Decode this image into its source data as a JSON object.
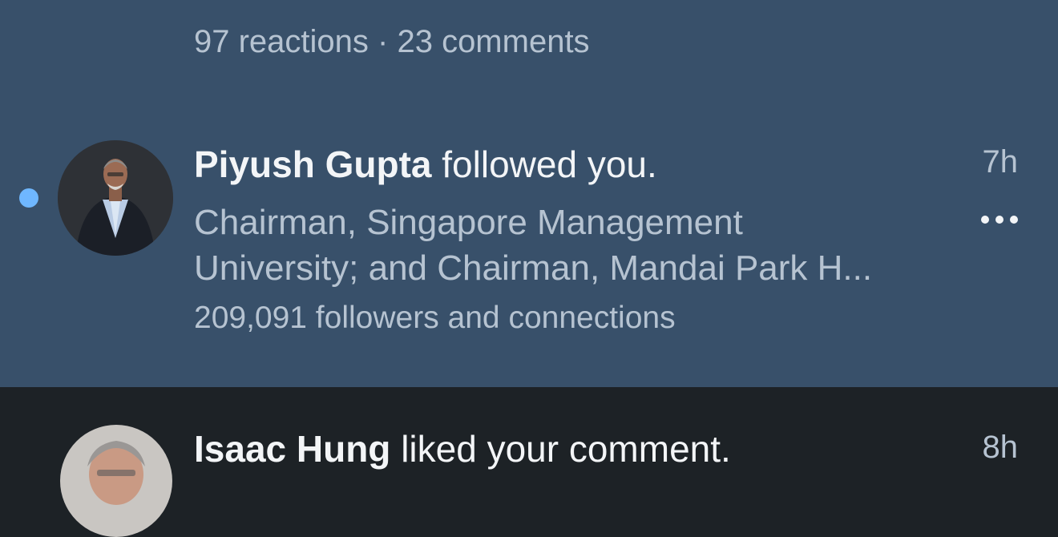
{
  "previous_post": {
    "reactions_summary": "97 reactions · 23 comments"
  },
  "notifications": [
    {
      "unread": true,
      "name": "Piyush Gupta",
      "action": " followed you.",
      "subtitle_line1": "Chairman, Singapore Management",
      "subtitle_line2": "University; and Chairman, Mandai Park H...",
      "followers": "209,091 followers and connections",
      "time": "7h",
      "avatar_icon": "person-photo-icon",
      "more_icon": "more-options-icon"
    },
    {
      "unread": false,
      "name": "Isaac Hung",
      "action": " liked your comment.",
      "time": "8h",
      "avatar_icon": "person-photo-icon"
    }
  ],
  "colors": {
    "unread_background": "#38506a",
    "read_background": "#1d2226",
    "unread_dot": "#6fb7ff",
    "primary_text": "#f3f5f7",
    "secondary_text": "#b6c3d1"
  }
}
